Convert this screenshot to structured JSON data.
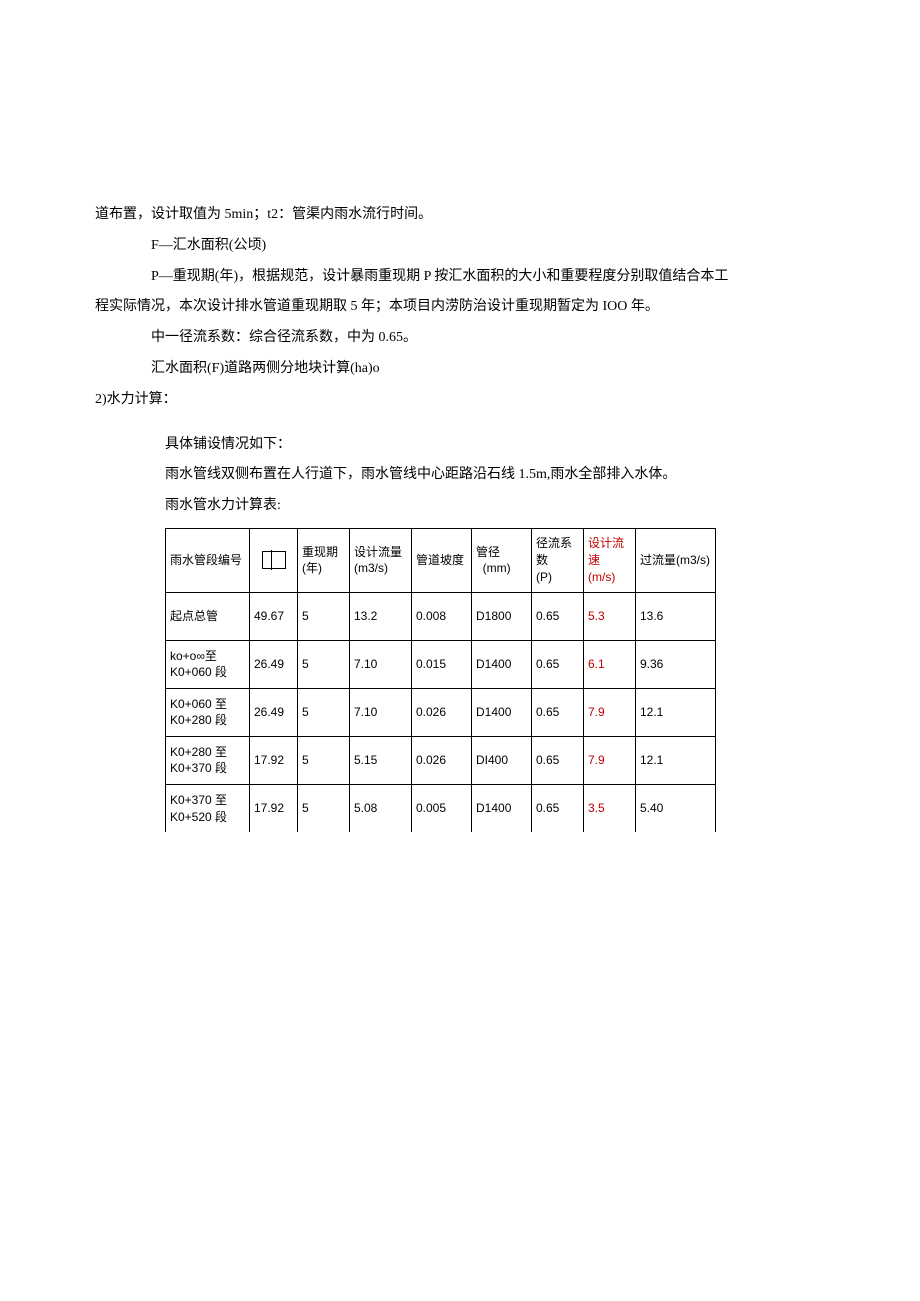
{
  "paragraphs": {
    "p1": "道布置，设计取值为 5min；t2：管渠内雨水流行时间。",
    "p2": "F—汇水面积(公顷)",
    "p3": "P—重现期(年)，根据规范，设计暴雨重现期 P 按汇水面积的大小和重要程度分别取值结合本工",
    "p4": "程实际情况，本次设计排水管道重现期取 5 年；本项目内涝防治设计重现期暂定为 IOO 年。",
    "p5": "中一径流系数：综合径流系数，中为 0.65。",
    "p6": "汇水面积(F)道路两侧分地块计算(ha)o",
    "p7": "2)水力计算：",
    "p8": "具体铺设情况如下：",
    "p9": "雨水管线双侧布置在人行道下，雨水管线中心距路沿石线 1.5m,雨水全部排入水体。",
    "p10": "雨水管水力计算表:"
  },
  "table": {
    "headers": {
      "h1": "雨水管段编号",
      "h3a": "重现期",
      "h3b": "(年)",
      "h4a": "设计流量",
      "h4b": "(m3/s)",
      "h5": "管道坡度",
      "h6a": "管径",
      "h6b": "(mm)",
      "h7a": "径流系数",
      "h7b": "(P)",
      "h8a": "设计流速",
      "h8b": "(m/s)",
      "h9": "过流量(m3/s)"
    },
    "rows": [
      {
        "c1": "起点总管",
        "c2": "49.67",
        "c3": "5",
        "c4": "13.2",
        "c5": "0.008",
        "c6": "D1800",
        "c7": "0.65",
        "c8": "5.3",
        "c9": "13.6"
      },
      {
        "c1": "ko+o∞至\nK0+060 段",
        "c2": "26.49",
        "c3": "5",
        "c4": "7.10",
        "c5": "0.015",
        "c6": "D1400",
        "c7": "0.65",
        "c8": "6.1",
        "c9": "9.36"
      },
      {
        "c1": "K0+060 至\nK0+280 段",
        "c2": "26.49",
        "c3": "5",
        "c4": "7.10",
        "c5": "0.026",
        "c6": "D1400",
        "c7": "0.65",
        "c8": "7.9",
        "c9": "12.1"
      },
      {
        "c1": "K0+280 至\nK0+370 段",
        "c2": "17.92",
        "c3": "5",
        "c4": "5.15",
        "c5": "0.026",
        "c6": "DI400",
        "c7": "0.65",
        "c8": "7.9",
        "c9": "12.1"
      },
      {
        "c1": "K0+370 至\nK0+520 段",
        "c2": "17.92",
        "c3": "5",
        "c4": "5.08",
        "c5": "0.005",
        "c6": "D1400",
        "c7": "0.65",
        "c8": "3.5",
        "c9": "5.40"
      }
    ]
  }
}
